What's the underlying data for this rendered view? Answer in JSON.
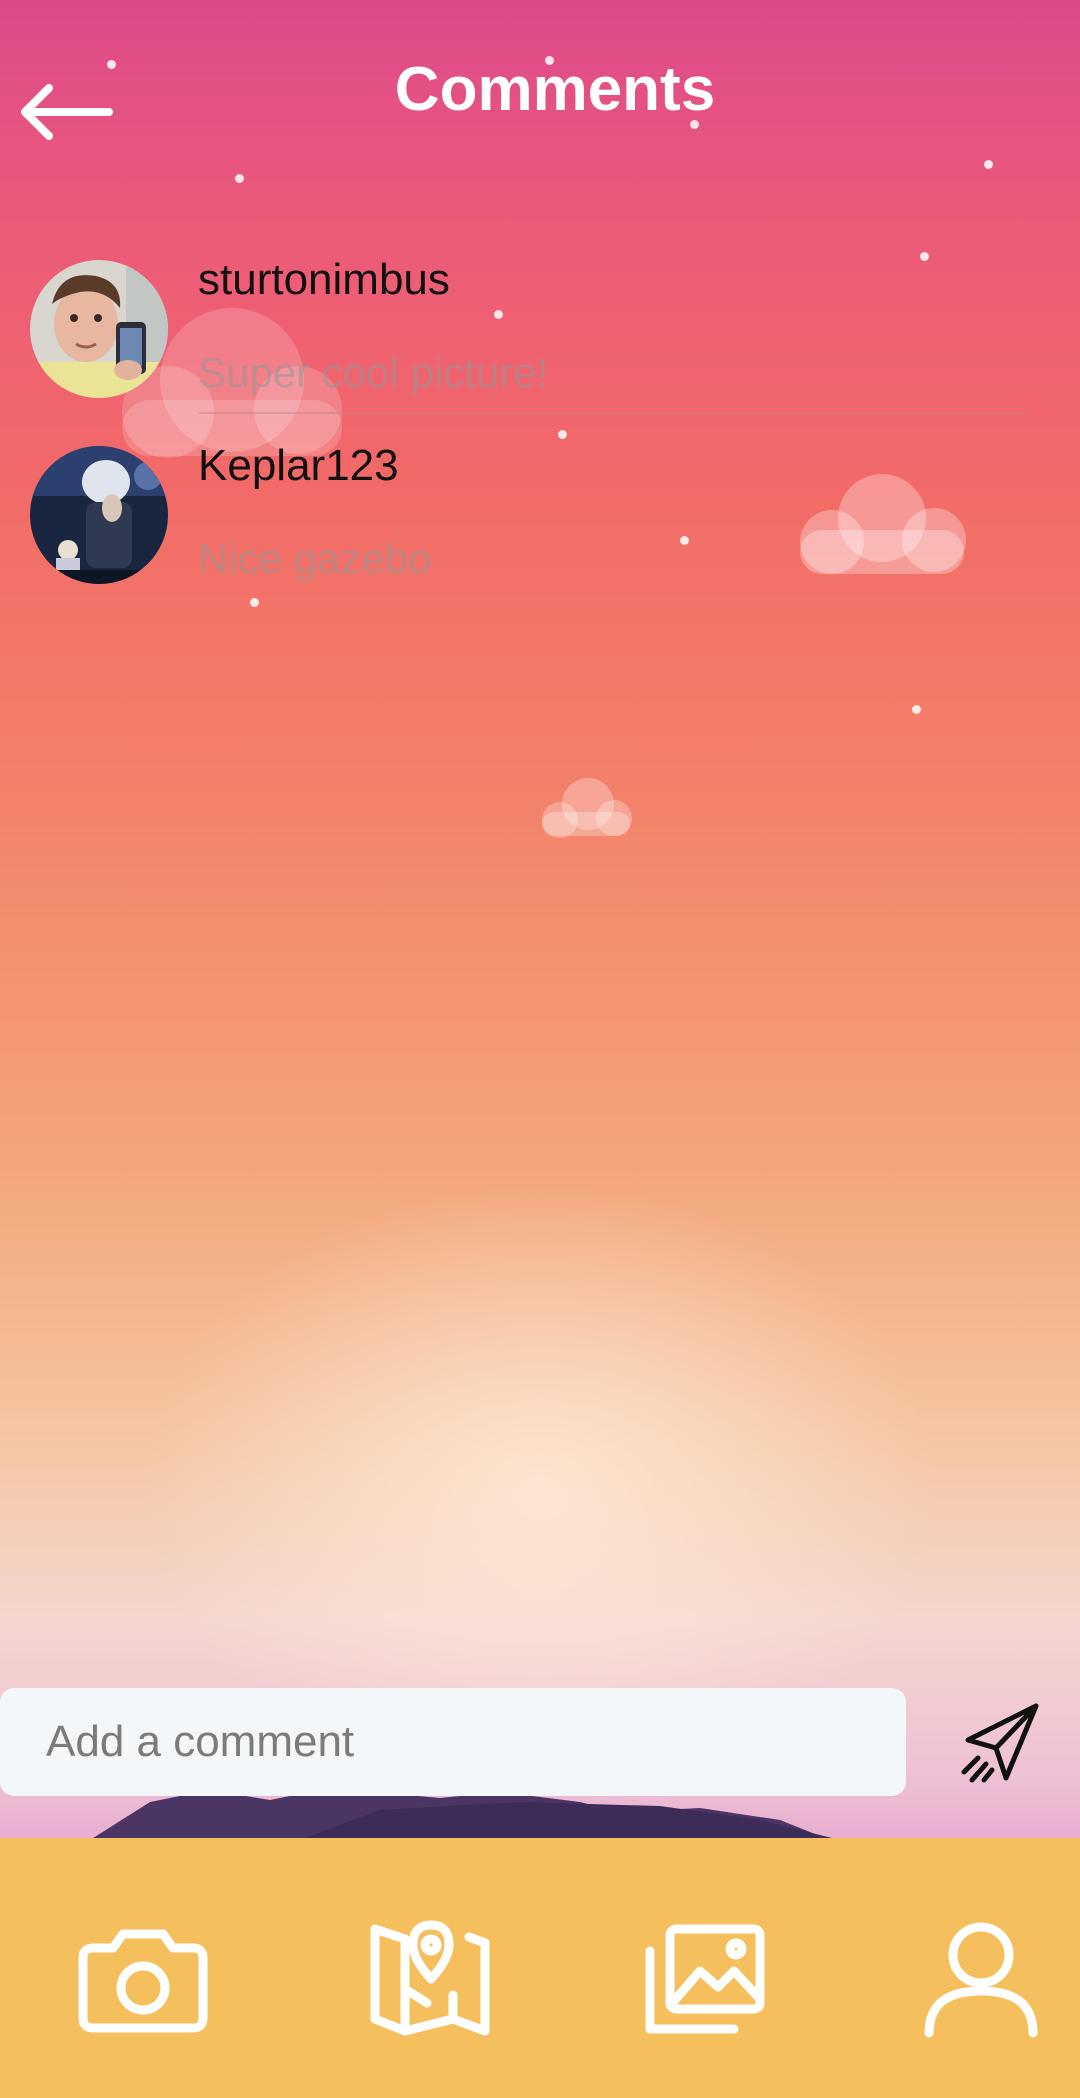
{
  "header": {
    "title": "Comments",
    "back_icon": "arrow-left-icon"
  },
  "comments": [
    {
      "username": "sturtonimbus",
      "text": "Super cool picture!"
    },
    {
      "username": "Keplar123",
      "text": "Nice gazebo"
    }
  ],
  "composer": {
    "placeholder": "Add a comment",
    "value": "",
    "send_icon": "send-paper-plane-icon"
  },
  "bottom_nav": {
    "background": "#f5bf5e",
    "items": [
      {
        "icon": "camera-icon"
      },
      {
        "icon": "map-location-icon"
      },
      {
        "icon": "gallery-icon"
      },
      {
        "icon": "profile-icon"
      }
    ]
  },
  "colors": {
    "title": "#ffffff",
    "nav_background": "#f5bf5e",
    "input_background": "#f3f7fa"
  }
}
